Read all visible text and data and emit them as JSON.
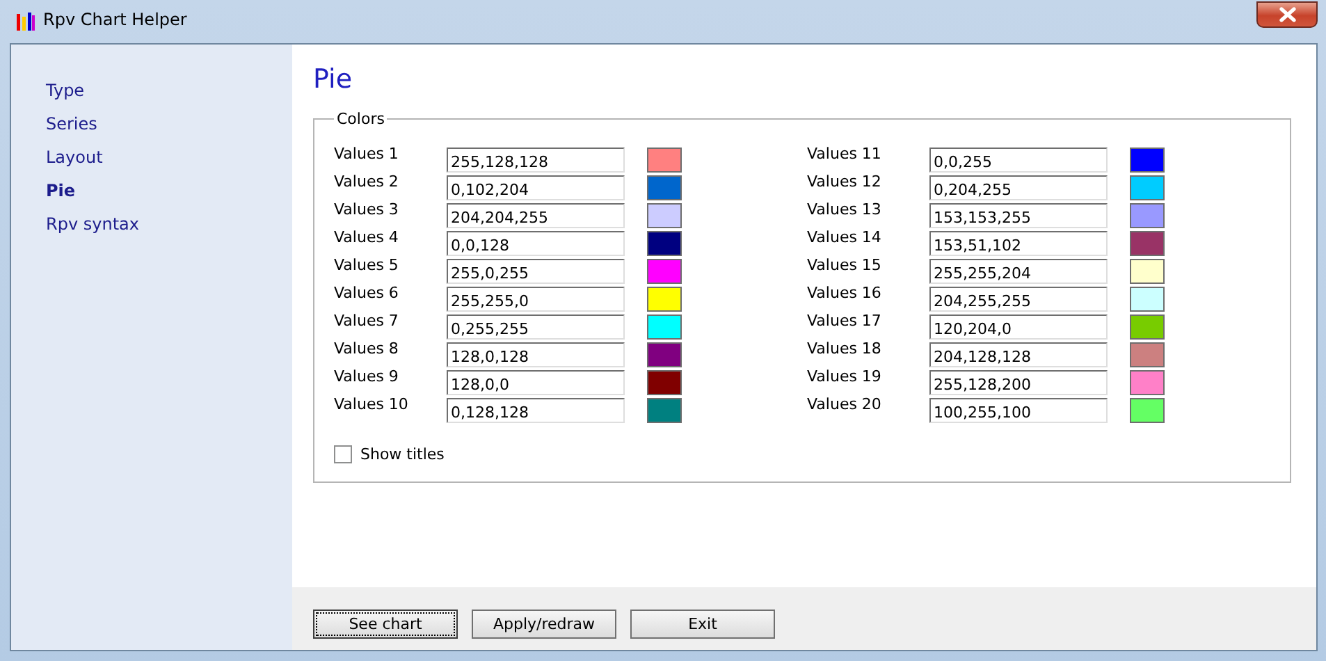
{
  "window": {
    "title": "Rpv Chart Helper"
  },
  "sidebar": {
    "items": [
      {
        "label": "Type",
        "selected": false
      },
      {
        "label": "Series",
        "selected": false
      },
      {
        "label": "Layout",
        "selected": false
      },
      {
        "label": "Pie",
        "selected": true
      },
      {
        "label": "Rpv syntax",
        "selected": false
      }
    ]
  },
  "page": {
    "heading": "Pie"
  },
  "colors": {
    "legend": "Colors",
    "items": [
      {
        "label": "Values 1",
        "value": "255,128,128",
        "color": "#ff8080"
      },
      {
        "label": "Values 2",
        "value": "0,102,204",
        "color": "#0066cc"
      },
      {
        "label": "Values 3",
        "value": "204,204,255",
        "color": "#ccccff"
      },
      {
        "label": "Values 4",
        "value": "0,0,128",
        "color": "#000080"
      },
      {
        "label": "Values 5",
        "value": "255,0,255",
        "color": "#ff00ff"
      },
      {
        "label": "Values 6",
        "value": "255,255,0",
        "color": "#ffff00"
      },
      {
        "label": "Values 7",
        "value": "0,255,255",
        "color": "#00ffff"
      },
      {
        "label": "Values 8",
        "value": "128,0,128",
        "color": "#800080"
      },
      {
        "label": "Values 9",
        "value": "128,0,0",
        "color": "#800000"
      },
      {
        "label": "Values 10",
        "value": "0,128,128",
        "color": "#008080"
      },
      {
        "label": "Values 11",
        "value": "0,0,255",
        "color": "#0000ff"
      },
      {
        "label": "Values 12",
        "value": "0,204,255",
        "color": "#00ccff"
      },
      {
        "label": "Values 13",
        "value": "153,153,255",
        "color": "#9999ff"
      },
      {
        "label": "Values 14",
        "value": "153,51,102",
        "color": "#993366"
      },
      {
        "label": "Values 15",
        "value": "255,255,204",
        "color": "#ffffcc"
      },
      {
        "label": "Values 16",
        "value": "204,255,255",
        "color": "#ccffff"
      },
      {
        "label": "Values 17",
        "value": "120,204,0",
        "color": "#78cc00"
      },
      {
        "label": "Values 18",
        "value": "204,128,128",
        "color": "#cc8080"
      },
      {
        "label": "Values 19",
        "value": "255,128,200",
        "color": "#ff80c8"
      },
      {
        "label": "Values 20",
        "value": "100,255,100",
        "color": "#64ff64"
      }
    ],
    "show_titles": {
      "label": "Show titles",
      "checked": false
    }
  },
  "buttons": [
    {
      "label": "See chart",
      "focused": true
    },
    {
      "label": "Apply/redraw",
      "focused": false
    },
    {
      "label": "Exit",
      "focused": false
    }
  ]
}
